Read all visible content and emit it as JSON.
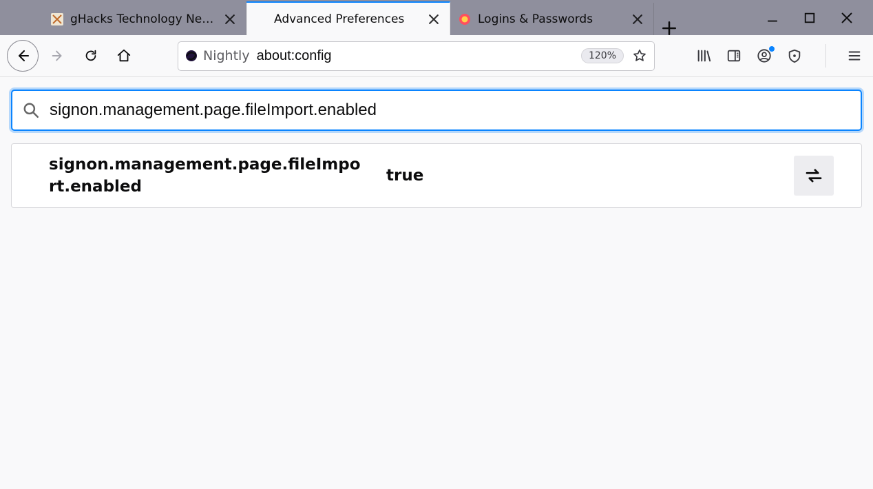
{
  "window": {
    "tabs": [
      {
        "title": "gHacks Technology News",
        "active": false,
        "favicon": "ghacks"
      },
      {
        "title": "Advanced Preferences",
        "active": true,
        "favicon": "none"
      },
      {
        "title": "Logins & Passwords",
        "active": false,
        "favicon": "lockwise"
      }
    ]
  },
  "navbar": {
    "identity_label": "Nightly",
    "url": "about:config",
    "zoom": "120%"
  },
  "config": {
    "search_value": "signon.management.page.fileImport.enabled",
    "result": {
      "name": "signon.management.page.fileImport.enabled",
      "value": "true"
    }
  }
}
